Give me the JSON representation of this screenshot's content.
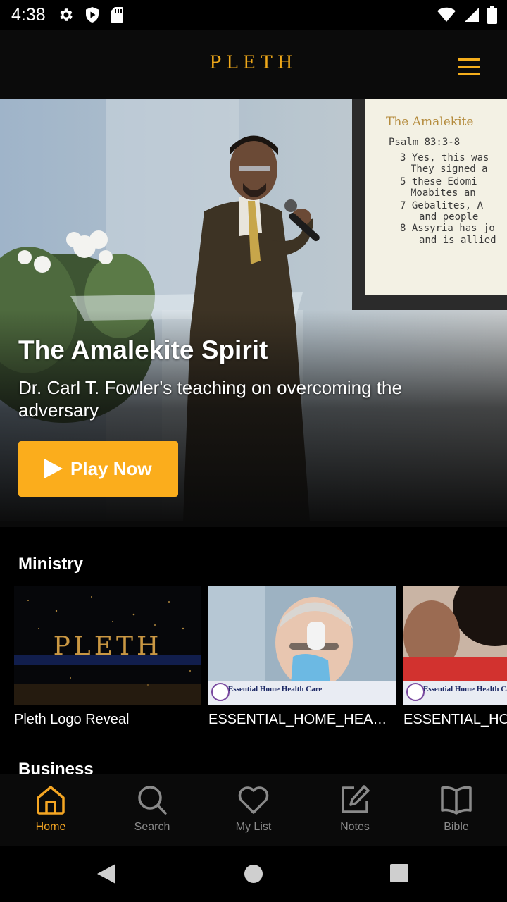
{
  "status_bar": {
    "time": "4:38"
  },
  "app": {
    "brand": "PLETH"
  },
  "hero": {
    "title": "The Amalekite Spirit",
    "subtitle": "Dr. Carl T. Fowler's teaching on overcoming the adversary",
    "play_label": "Play Now",
    "slide_heading": "The Amalekite",
    "slide_lines": [
      "Psalm 83:3-8",
      "3 Yes, this was",
      "They signed a",
      "5 these Edomi",
      "Moabites an",
      "7 Gebalites, A",
      "and people",
      "8 Assyria has jo",
      "and is allied"
    ]
  },
  "sections": [
    {
      "title": "Ministry",
      "items": [
        {
          "caption": "Pleth Logo Reveal",
          "thumb_text": "PLETH"
        },
        {
          "caption": "ESSENTIAL_HOME_HEALT...",
          "banner_text": "Essential Home Health Care"
        },
        {
          "caption": "ESSENTIAL_HO",
          "banner_text": "Essential Home Health Care"
        }
      ]
    },
    {
      "title": "Business"
    }
  ],
  "bottom_nav": [
    {
      "label": "Home",
      "icon": "home-icon",
      "active": true
    },
    {
      "label": "Search",
      "icon": "search-icon",
      "active": false
    },
    {
      "label": "My List",
      "icon": "heart-icon",
      "active": false
    },
    {
      "label": "Notes",
      "icon": "edit-icon",
      "active": false
    },
    {
      "label": "Bible",
      "icon": "book-icon",
      "active": false
    }
  ],
  "colors": {
    "accent": "#FBAD1C",
    "background": "#000000",
    "inactive": "#8A8A8A"
  }
}
